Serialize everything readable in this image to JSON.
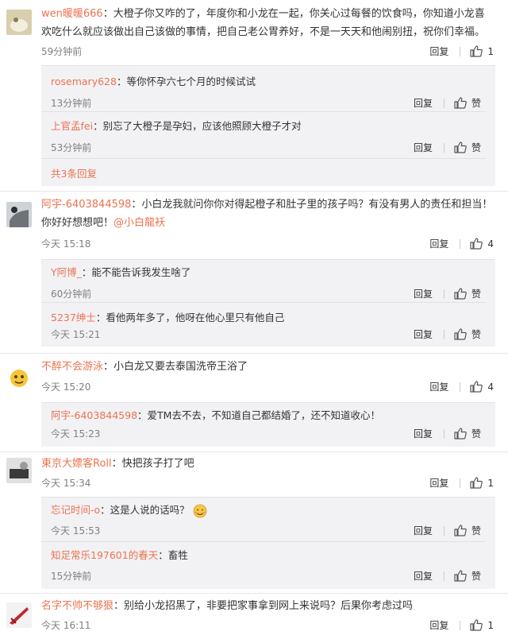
{
  "ui": {
    "reply_label": "回复",
    "like_label": "赞"
  },
  "comments": [
    {
      "user": "wen暖暖666",
      "text_line1": "：大橙子你又咋的了，年度你和小龙在一起，你关心过每餐的饮食吗，你知道小龙喜",
      "text_line2": "欢吃什么就应该做出自己该做的事情，把自己老公胃养好，不是一天天和他闹别扭，祝你们幸福。",
      "time": "59分钟前",
      "likes": "1",
      "replies": [
        {
          "user": "rosemary628",
          "text": "：等你怀孕六七个月的时候试试",
          "time": "13分钟前"
        },
        {
          "user": "上官孟fei",
          "text": "：别忘了大橙子是孕妇，应该他照顾大橙子才对",
          "time": "53分钟前"
        }
      ],
      "more": "共3条回复"
    },
    {
      "user": "阿宇-6403844598",
      "text_line1": "：小白龙我就问你你对得起橙子和肚子里的孩子吗？有没有男人的责任和担当！",
      "text_line2": "你好好想想吧！",
      "mention": "@小白龍袄",
      "time": "今天 15:18",
      "likes": "4",
      "replies": [
        {
          "user": "Y阿博_",
          "text": "：能不能告诉我发生啥了",
          "time": "60分钟前"
        },
        {
          "user": "5237绅士",
          "text": "：看他两年多了，他呀在他心里只有他自己",
          "time": "今天 15:21"
        }
      ]
    },
    {
      "user": "不醉不会游泳",
      "text_line1": "：小白龙又要去泰国洗帝王浴了",
      "time": "今天 15:20",
      "likes": "4",
      "replies": [
        {
          "user": "阿宇-6403844598",
          "text": "：爱TM去不去，不知道自己都结婚了，还不知道收心！",
          "time": "今天 15:23"
        }
      ]
    },
    {
      "user": "東京大嫖客Roll",
      "text_line1": "：快把孩子打了吧",
      "time": "今天 15:34",
      "likes": "1",
      "replies": [
        {
          "user": "忘记时间-o",
          "text": "：这是人说的话吗？",
          "time": "今天 15:53"
        },
        {
          "user": "知足常乐197601的春天",
          "text": "：畜牲",
          "time": "15分钟前"
        }
      ]
    },
    {
      "user": "名字不帅不够狠",
      "text_line1": "：别给小龙招黑了，非要把家事拿到网上来说吗？后果你考虑过吗",
      "time": "今天 16:11",
      "likes": "1",
      "replies": []
    }
  ]
}
